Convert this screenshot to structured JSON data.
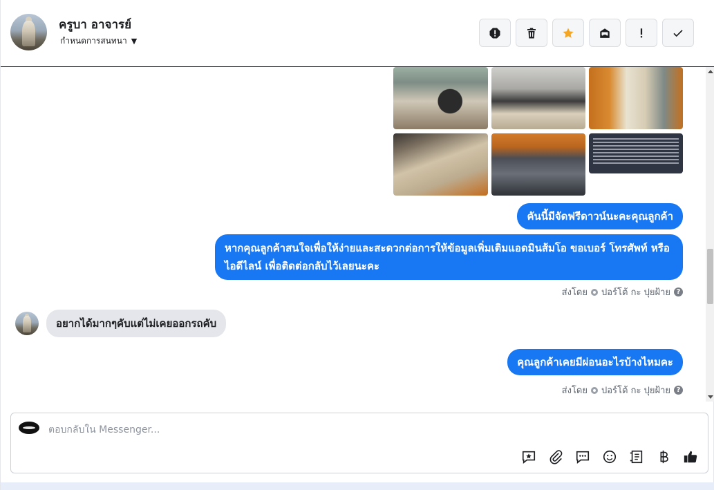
{
  "header": {
    "contact_name": "ครูบา อาจารย์",
    "conversation_menu_label": "กำหนดการสนทนา",
    "actions": [
      {
        "name": "spam-button",
        "icon": "alert-octagon-icon"
      },
      {
        "name": "delete-button",
        "icon": "trash-icon"
      },
      {
        "name": "star-button",
        "icon": "star-icon",
        "color": "#f5a623"
      },
      {
        "name": "mark-unread-button",
        "icon": "envelope-icon"
      },
      {
        "name": "follow-up-button",
        "icon": "exclamation-icon"
      },
      {
        "name": "done-button",
        "icon": "check-icon"
      }
    ]
  },
  "messages": {
    "out_1": "คันนี้มีจัดฟรีดาวน์นะคะคุณลูกค้า",
    "out_2": "หากคุณลูกค้าสนใจเพื่อให้ง่ายและสะดวกต่อการให้ข้อมูลเพิ่มเติมแอดมินส้มโอ ขอเบอร์ โทรศัพท์ หรือ ไอดีไลน์ เพื่อติดต่อกลับไว้เลยนะคะ",
    "sent_by_1": {
      "prefix": "ส่งโดย",
      "agent": "ปอร์โต้ กะ ปุยฝ้าย"
    },
    "in_1": "อยากได้มากๆคับแต่ไม่เคยออกรถคับ",
    "out_3": "คุณลูกค้าเคยมีผ่อนอะไรบ้างไหมคะ",
    "sent_by_2": {
      "prefix": "ส่งโดย",
      "agent": "ปอร์โต้ กะ ปุยฝ้าย"
    }
  },
  "composer": {
    "placeholder": "ตอบกลับใน Messenger...",
    "tools": [
      "saved-reply-icon",
      "attachment-icon",
      "message-icon",
      "emoji-icon",
      "notes-icon",
      "baht-icon",
      "like-icon"
    ]
  },
  "colors": {
    "accent": "#1877f2",
    "incoming_bubble": "#e4e6eb"
  }
}
